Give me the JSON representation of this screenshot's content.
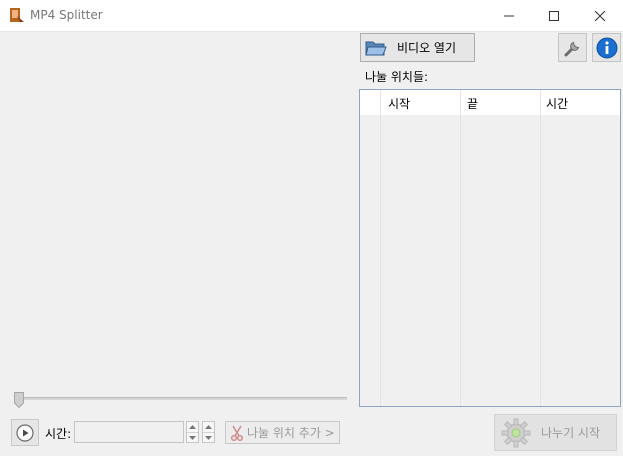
{
  "window": {
    "title": "MP4 Splitter"
  },
  "toolbar": {
    "open_video_label": "비디오 열기"
  },
  "split_list": {
    "label": "나눌 위치들:",
    "columns": [
      "시작",
      "끝",
      "시간"
    ],
    "rows": []
  },
  "controls": {
    "time_label": "시간:",
    "time_value": "",
    "add_split_label": "나눌 위치 추가 >",
    "start_split_label": "나누기 시작"
  },
  "icons": {
    "app": "app-icon",
    "minimize": "minimize-icon",
    "maximize": "maximize-icon",
    "close": "close-icon",
    "folder": "folder-open-icon",
    "settings": "wrench-icon",
    "info": "info-icon",
    "play": "play-icon",
    "scissors": "scissors-icon",
    "gear": "gear-icon"
  },
  "colors": {
    "info_blue": "#1a6fd1",
    "grid_border": "#8fa3c2",
    "disabled_text": "#9a9a9a"
  }
}
